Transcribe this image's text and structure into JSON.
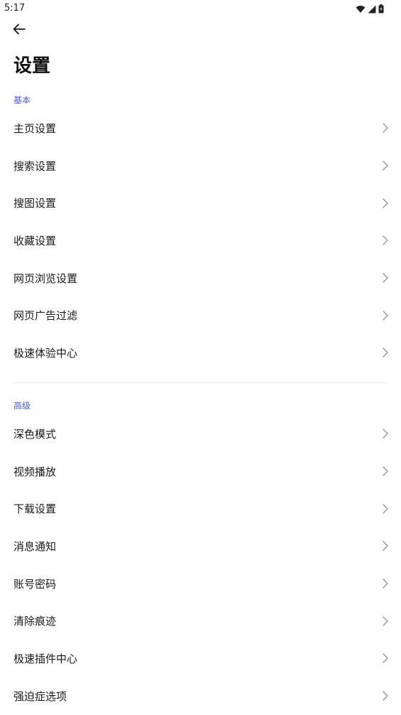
{
  "status_bar": {
    "time": "5:17",
    "icons": [
      "wifi-icon",
      "signal-icon",
      "battery-icon"
    ]
  },
  "header": {
    "back_icon": "arrow-left-icon",
    "title": "设置"
  },
  "sections": [
    {
      "title": "基本",
      "items": [
        {
          "label": "主页设置"
        },
        {
          "label": "搜索设置"
        },
        {
          "label": "搜图设置"
        },
        {
          "label": "收藏设置"
        },
        {
          "label": "网页浏览设置"
        },
        {
          "label": "网页广告过滤"
        },
        {
          "label": "极速体验中心"
        }
      ]
    },
    {
      "title": "高级",
      "items": [
        {
          "label": "深色模式"
        },
        {
          "label": "视频播放"
        },
        {
          "label": "下载设置"
        },
        {
          "label": "消息通知"
        },
        {
          "label": "账号密码"
        },
        {
          "label": "清除痕迹"
        },
        {
          "label": "极速插件中心"
        },
        {
          "label": "强迫症选项"
        }
      ]
    }
  ],
  "colors": {
    "accent": "#4a5bd6",
    "text": "#1a1a1a",
    "chevron": "#9a9a9a",
    "divider": "#ececec"
  }
}
